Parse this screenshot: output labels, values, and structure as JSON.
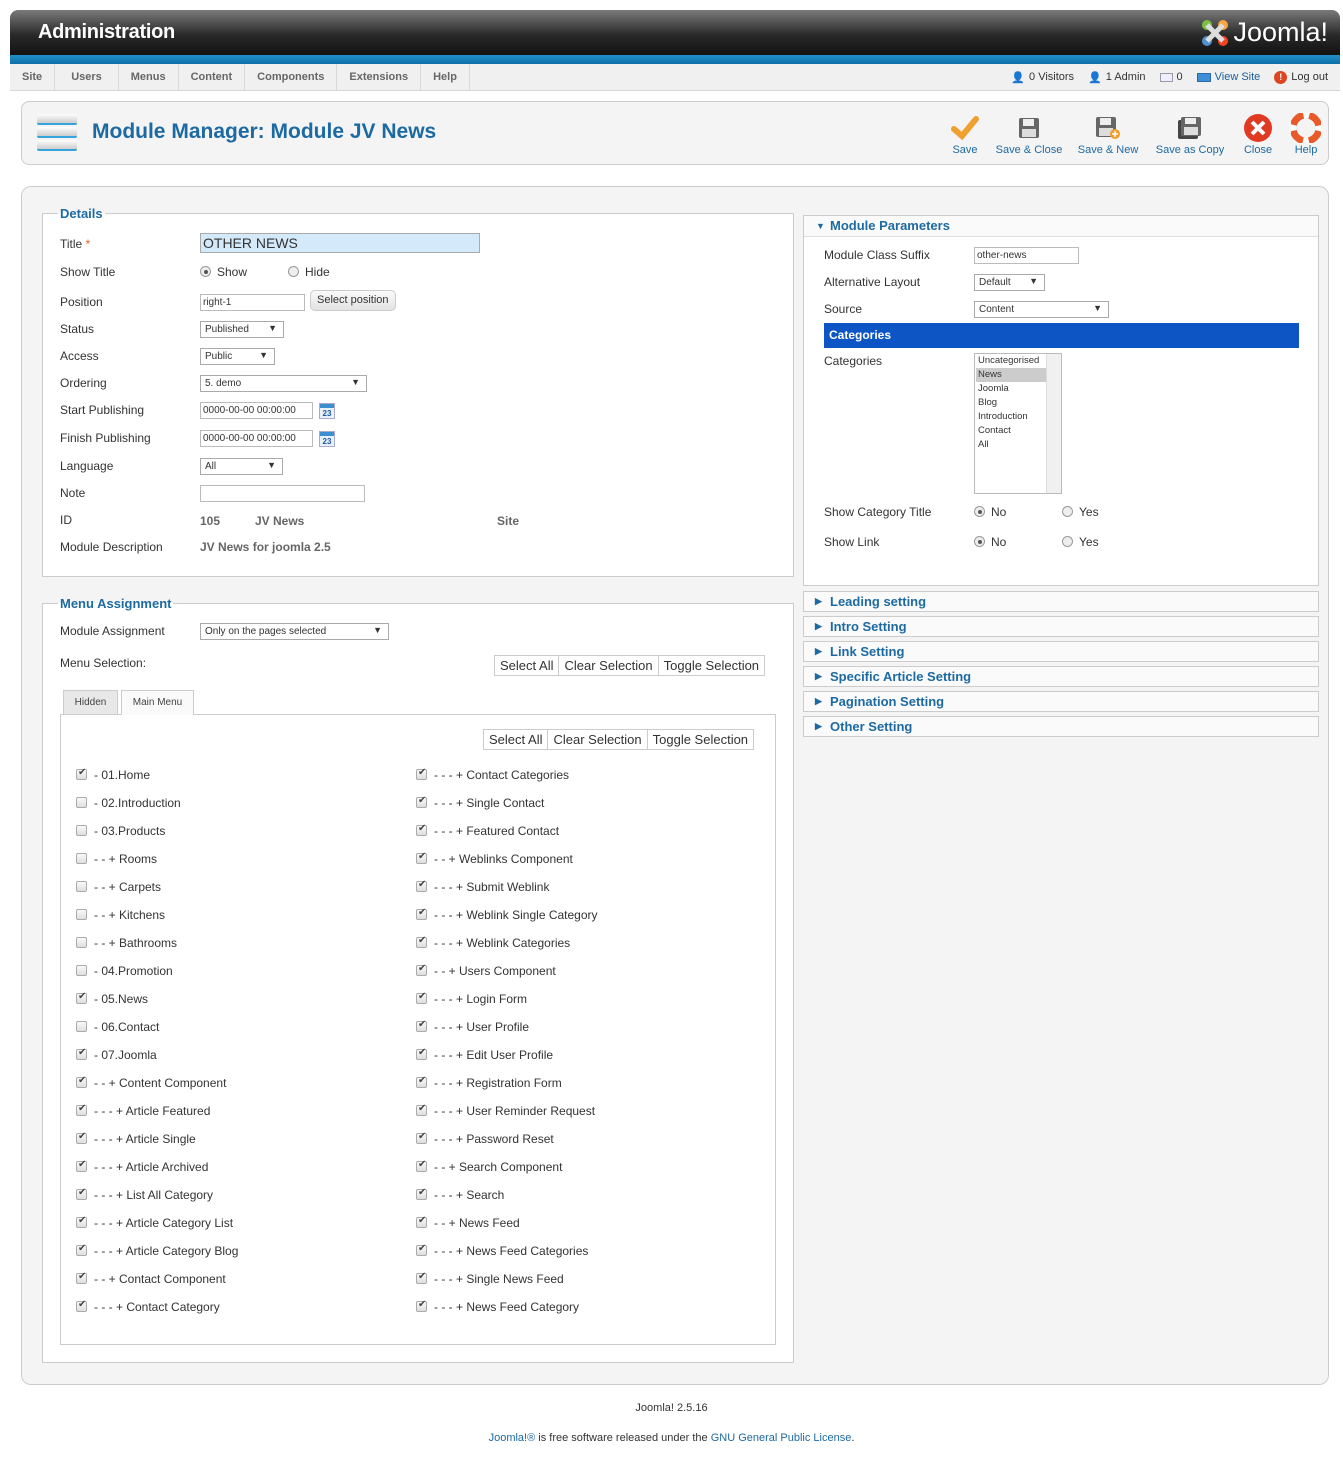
{
  "header": {
    "title": "Administration",
    "logo_text": "Joomla!"
  },
  "menu": [
    "Site",
    "Users",
    "Menus",
    "Content",
    "Components",
    "Extensions",
    "Help"
  ],
  "status": {
    "visitors": "0 Visitors",
    "admin": "1 Admin",
    "messages": "0",
    "view_site": "View Site",
    "logout": "Log out"
  },
  "page": {
    "title": "Module Manager: Module JV News"
  },
  "toolbar": {
    "save": "Save",
    "save_close": "Save & Close",
    "save_new": "Save & New",
    "save_copy": "Save as Copy",
    "close": "Close",
    "help": "Help"
  },
  "details": {
    "legend": "Details",
    "title_label": "Title",
    "title_required": "*",
    "title_value": "OTHER NEWS",
    "show_title_label": "Show Title",
    "show": "Show",
    "hide": "Hide",
    "position_label": "Position",
    "position_value": "right-1",
    "select_position": "Select position",
    "status_label": "Status",
    "status_value": "Published",
    "access_label": "Access",
    "access_value": "Public",
    "ordering_label": "Ordering",
    "ordering_value": "5. demo",
    "start_label": "Start Publishing",
    "start_value": "0000-00-00 00:00:00",
    "finish_label": "Finish Publishing",
    "finish_value": "0000-00-00 00:00:00",
    "calendar_day": "23",
    "language_label": "Language",
    "language_value": "All",
    "note_label": "Note",
    "note_value": "",
    "id_label": "ID",
    "id_value": "105",
    "module_name": "JV News",
    "client": "Site",
    "desc_label": "Module Description",
    "desc_value": "JV News for joomla 2.5"
  },
  "assignment": {
    "legend": "Menu Assignment",
    "module_assignment_label": "Module Assignment",
    "module_assignment_value": "Only on the pages selected",
    "menu_selection_label": "Menu Selection:",
    "select_all": "Select All",
    "clear_selection": "Clear Selection",
    "toggle_selection": "Toggle Selection",
    "tabs": [
      "Hidden",
      "Main Menu"
    ],
    "left_items": [
      {
        "label": "- 01.Home",
        "checked": true
      },
      {
        "label": "- 02.Introduction",
        "checked": false
      },
      {
        "label": "- 03.Products",
        "checked": false
      },
      {
        "label": "- - + Rooms",
        "checked": false
      },
      {
        "label": "- - + Carpets",
        "checked": false
      },
      {
        "label": "- - + Kitchens",
        "checked": false
      },
      {
        "label": "- - + Bathrooms",
        "checked": false
      },
      {
        "label": "- 04.Promotion",
        "checked": false
      },
      {
        "label": "- 05.News",
        "checked": true
      },
      {
        "label": "- 06.Contact",
        "checked": false
      },
      {
        "label": "- 07.Joomla",
        "checked": true
      },
      {
        "label": "- - + Content Component",
        "checked": true
      },
      {
        "label": "- - - + Article Featured",
        "checked": true
      },
      {
        "label": "- - - + Article Single",
        "checked": true
      },
      {
        "label": "- - - + Article Archived",
        "checked": true
      },
      {
        "label": "- - - + List All Category",
        "checked": true
      },
      {
        "label": "- - - + Article Category List",
        "checked": true
      },
      {
        "label": "- - - + Article Category Blog",
        "checked": true
      },
      {
        "label": "- - + Contact Component",
        "checked": true
      },
      {
        "label": "- - - + Contact Category",
        "checked": true
      }
    ],
    "right_items": [
      {
        "label": "- - - + Contact Categories",
        "checked": true
      },
      {
        "label": "- - - + Single Contact",
        "checked": true
      },
      {
        "label": "- - - + Featured Contact",
        "checked": true
      },
      {
        "label": "- - + Weblinks Component",
        "checked": true
      },
      {
        "label": "- - - + Submit Weblink",
        "checked": true
      },
      {
        "label": "- - - + Weblink Single Category",
        "checked": true
      },
      {
        "label": "- - - + Weblink Categories",
        "checked": true
      },
      {
        "label": "- - + Users Component",
        "checked": true
      },
      {
        "label": "- - - + Login Form",
        "checked": true
      },
      {
        "label": "- - - + User Profile",
        "checked": true
      },
      {
        "label": "- - - + Edit User Profile",
        "checked": true
      },
      {
        "label": "- - - + Registration Form",
        "checked": true
      },
      {
        "label": "- - - + User Reminder Request",
        "checked": true
      },
      {
        "label": "- - - + Password Reset",
        "checked": true
      },
      {
        "label": "- - + Search Component",
        "checked": true
      },
      {
        "label": "- - - + Search",
        "checked": true
      },
      {
        "label": "- - + News Feed",
        "checked": true
      },
      {
        "label": "- - - + News Feed Categories",
        "checked": true
      },
      {
        "label": "- - - + Single News Feed",
        "checked": true
      },
      {
        "label": "- - - + News Feed Category",
        "checked": true
      }
    ]
  },
  "params": {
    "title": "Module Parameters",
    "suffix_label": "Module Class Suffix",
    "suffix_value": "other-news",
    "layout_label": "Alternative Layout",
    "layout_value": "Default",
    "source_label": "Source",
    "source_value": "Content",
    "categories_header": "Categories",
    "categories_label": "Categories",
    "categories": [
      "Uncategorised",
      "News",
      "Joomla",
      "Blog",
      "Introduction",
      "Contact",
      "All"
    ],
    "categories_selected": "News",
    "show_cat_title_label": "Show Category Title",
    "show_link_label": "Show Link",
    "no": "No",
    "yes": "Yes"
  },
  "accordions": [
    "Leading setting",
    "Intro Setting",
    "Link Setting",
    "Specific Article Setting",
    "Pagination Setting",
    "Other Setting"
  ],
  "footer": {
    "version": "Joomla! 2.5.16",
    "joomla_link": "Joomla!®",
    "license_text": " is free software released under the ",
    "license_link": "GNU General Public License",
    "period": "."
  },
  "colors": {
    "accent": "#1d6aa3",
    "categories_bar": "#0d55c4"
  }
}
